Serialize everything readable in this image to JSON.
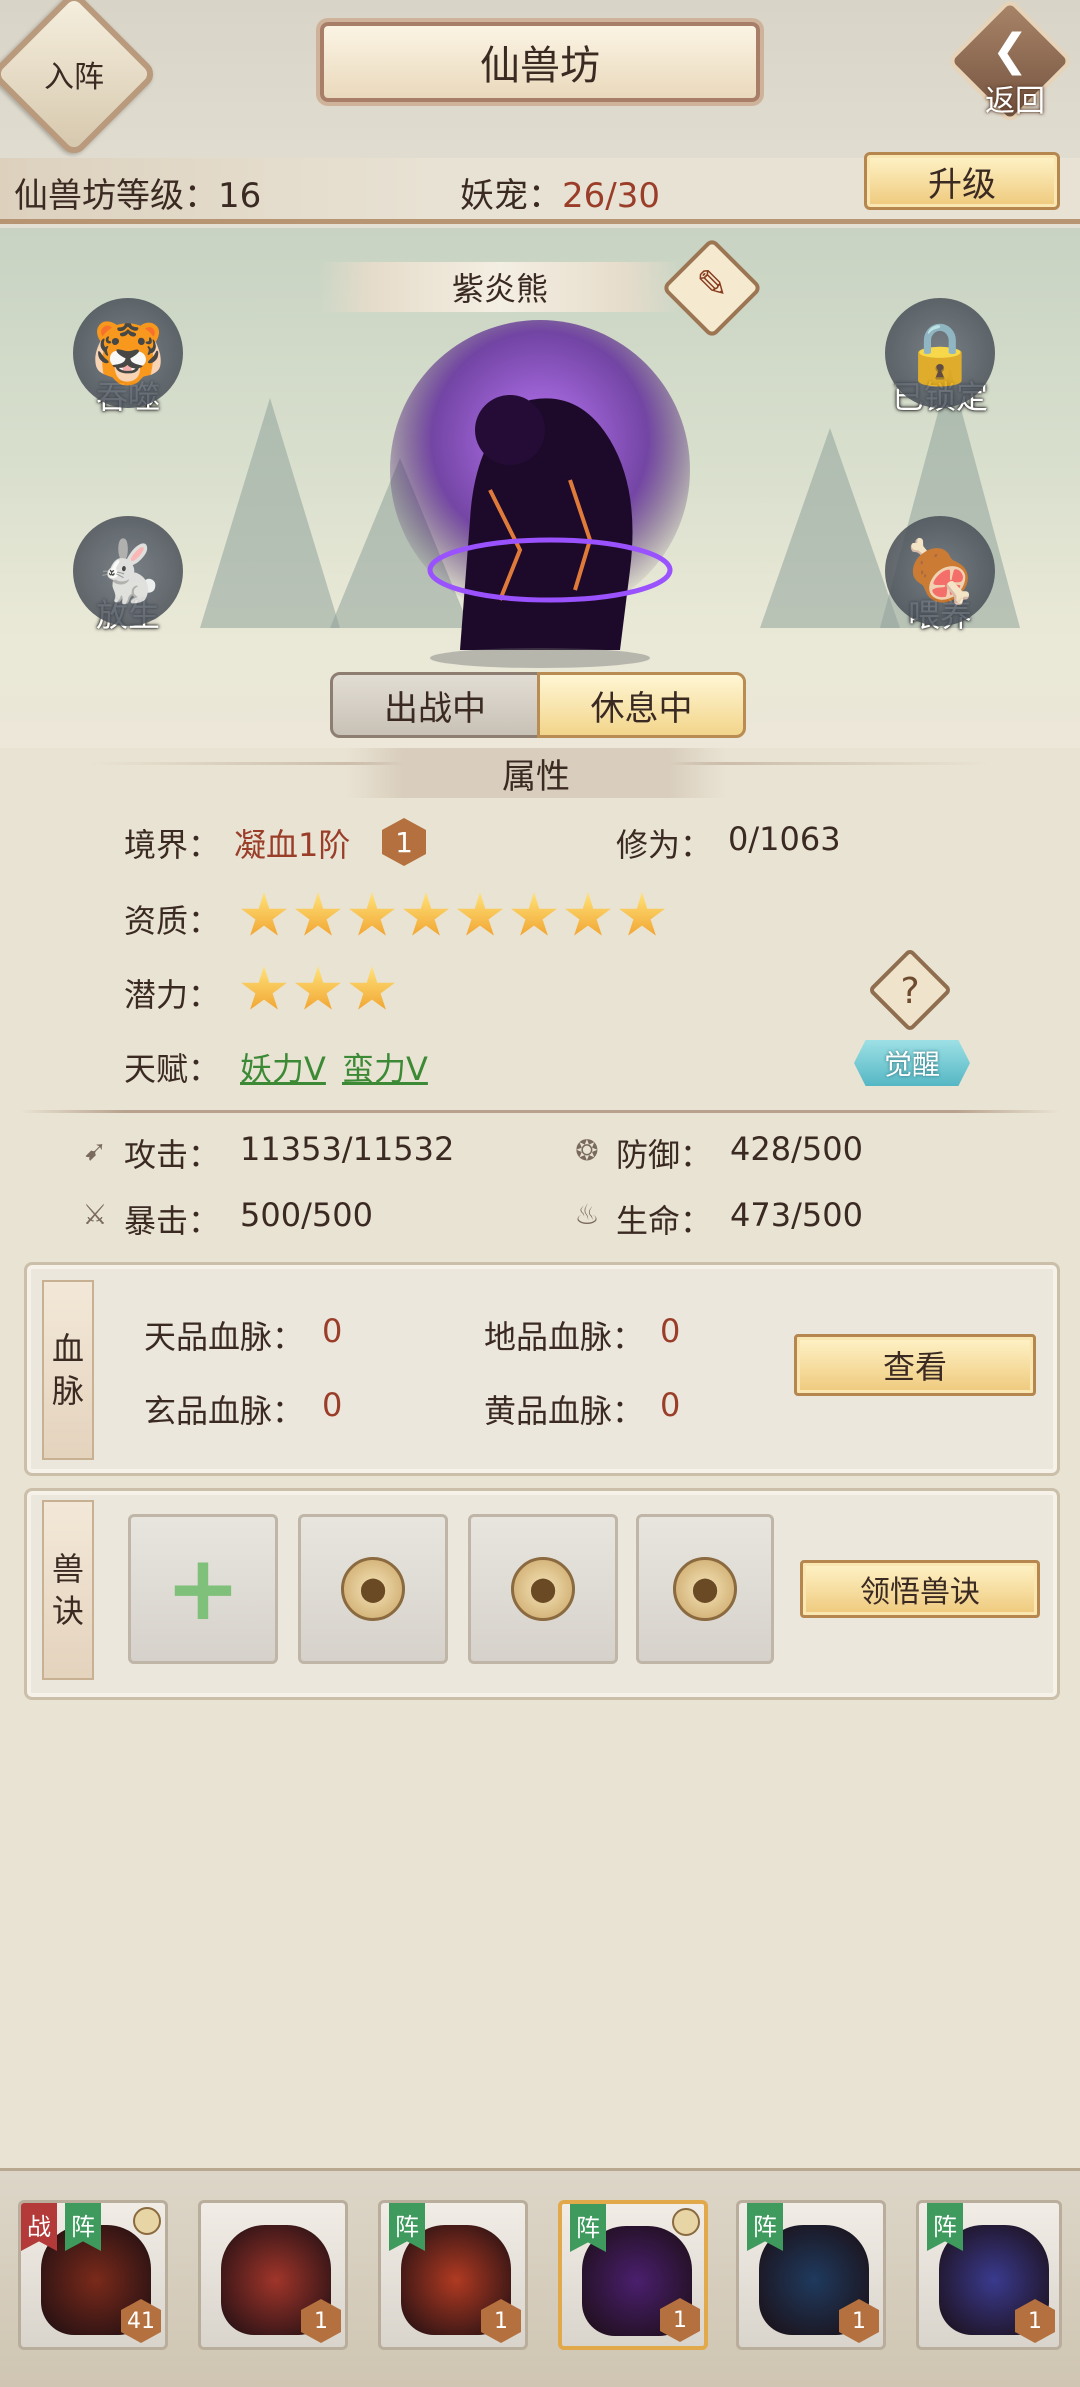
{
  "header": {
    "join_label": "入阵",
    "title": "仙兽坊",
    "back_label": "返回",
    "level_label": "仙兽坊等级：16",
    "pet_label": "妖宠：",
    "pet_count": "26/30",
    "upgrade_label": "升级"
  },
  "pet": {
    "name": "紫炎熊",
    "actions": {
      "devour": "吞噬",
      "release": "放生",
      "locked": "已锁定",
      "feed": "喂养"
    },
    "status_tabs": [
      "出战中",
      "休息中"
    ],
    "active_status": "休息中"
  },
  "attributes": {
    "tab_label": "属性",
    "realm_label": "境界：",
    "realm_value": "凝血1阶",
    "realm_badge": "1",
    "cultivation_label": "修为：",
    "cultivation_value": "0/1063",
    "aptitude_label": "资质：",
    "aptitude_stars": 8,
    "potential_label": "潜力：",
    "potential_stars": 3,
    "talent_label": "天赋：",
    "talents": [
      "妖力V",
      "蛮力V"
    ],
    "help_icon": "?",
    "awaken_label": "觉醒"
  },
  "stats": {
    "attack_label": "攻击：",
    "attack_value": "11353/11532",
    "defense_label": "防御：",
    "defense_value": "428/500",
    "crit_label": "暴击：",
    "crit_value": "500/500",
    "hp_label": "生命：",
    "hp_value": "473/500"
  },
  "bloodline": {
    "tab": [
      "血",
      "脉"
    ],
    "tian_label": "天品血脉：",
    "tian_value": "0",
    "di_label": "地品血脉：",
    "di_value": "0",
    "xuan_label": "玄品血脉：",
    "xuan_value": "0",
    "huang_label": "黄品血脉：",
    "huang_value": "0",
    "view_label": "查看"
  },
  "skills": {
    "tab": [
      "兽",
      "诀"
    ],
    "learn_label": "领悟兽诀"
  },
  "roster": [
    {
      "war": "战",
      "zhen": "阵",
      "level": "41",
      "locked": true,
      "color": "#7a2a1a",
      "selected": false
    },
    {
      "level": "1",
      "color": "#a0352a",
      "selected": false
    },
    {
      "zhen": "阵",
      "level": "1",
      "color": "#b03a22",
      "selected": false
    },
    {
      "zhen": "阵",
      "level": "1",
      "locked": true,
      "color": "#4a1f6e",
      "selected": true
    },
    {
      "zhen": "阵",
      "level": "1",
      "color": "#1f3a5e",
      "selected": false
    },
    {
      "zhen": "阵",
      "level": "1",
      "color": "#3a3a8e",
      "selected": false
    }
  ],
  "colors": {
    "accent_red": "#9a3e2a",
    "talent_green": "#3d8a36",
    "gold_button": "#eec97c"
  }
}
